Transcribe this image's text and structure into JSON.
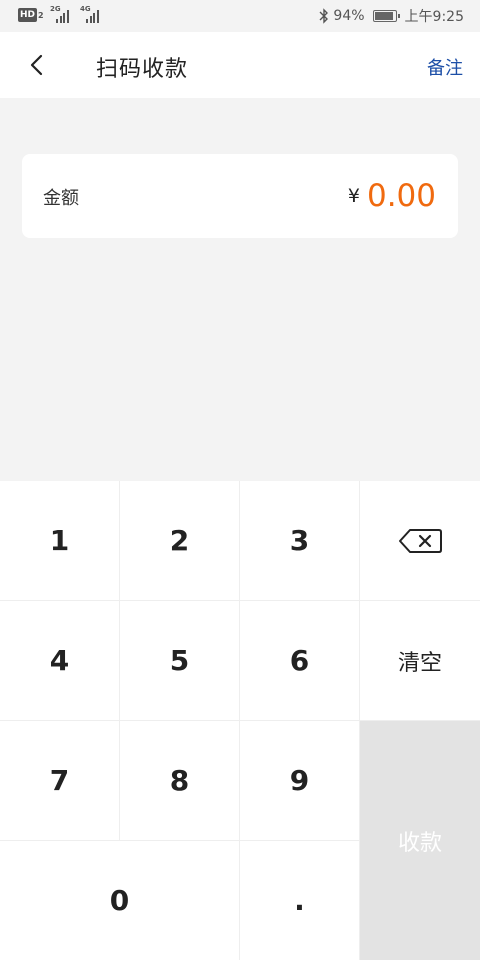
{
  "status_bar": {
    "network_badge": "HD",
    "network_badge_sub": "2",
    "sim1_tag": "2G",
    "sim2_tag": "4G",
    "battery_percent": "94%",
    "battery_level": 0.94,
    "time": "上午9:25"
  },
  "header": {
    "title": "扫码收款",
    "remark_label": "备注"
  },
  "amount_card": {
    "label": "金额",
    "currency_symbol": "¥",
    "value": "0.00"
  },
  "keypad": {
    "digits": [
      "1",
      "2",
      "3",
      "4",
      "5",
      "6",
      "7",
      "8",
      "9",
      "0",
      "."
    ],
    "clear_label": "清空",
    "submit_label": "收款",
    "delete_icon": "backspace-icon"
  },
  "colors": {
    "accent_link": "#1d4fa7",
    "amount_value": "#f06a0f",
    "submit_disabled_bg": "#e3e3e3"
  }
}
